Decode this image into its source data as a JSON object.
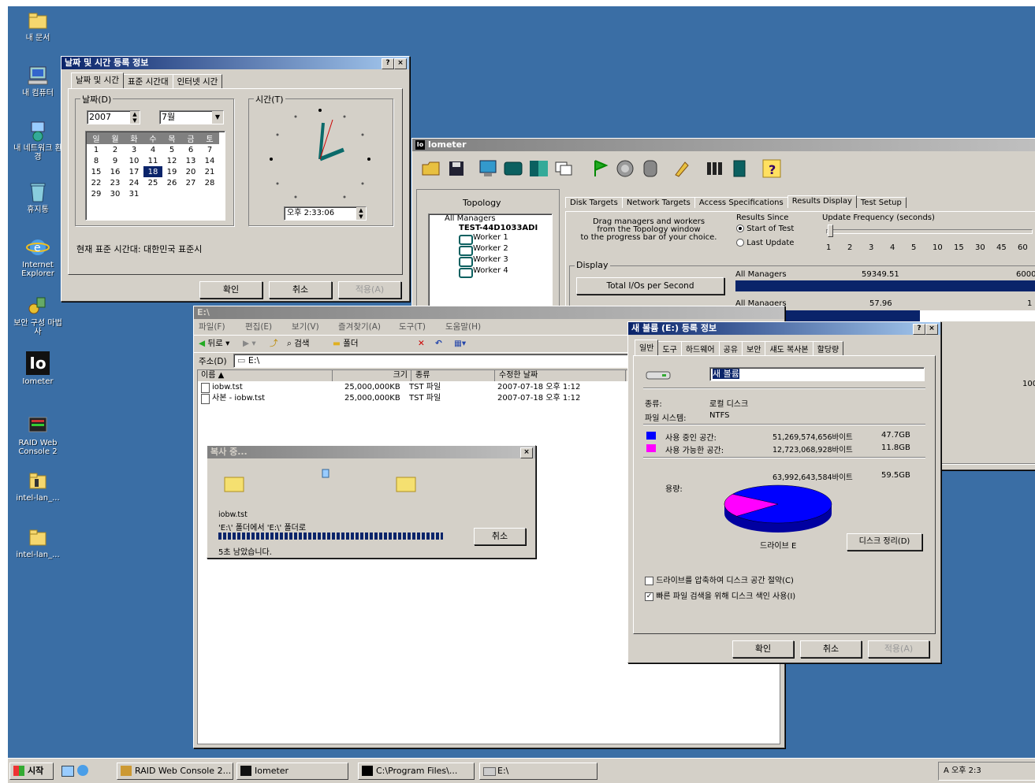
{
  "desktop": {
    "icons": [
      {
        "label": "내 문서"
      },
      {
        "label": "내 컴퓨터"
      },
      {
        "label": "내 네트워크 환경"
      },
      {
        "label": "휴지통"
      },
      {
        "label": "Internet Explorer"
      },
      {
        "label": "보안 구성 마법사"
      },
      {
        "label": "Iometer"
      },
      {
        "label": "RAID Web Console 2"
      },
      {
        "label": "intel-lan_..."
      },
      {
        "label": "intel-lan_..."
      }
    ]
  },
  "datetime": {
    "title": "날짜 및 시간 등록 정보",
    "tabs": [
      "날짜 및 시간",
      "표준 시간대",
      "인터넷 시간"
    ],
    "date_group": "날짜(D)",
    "year": "2007",
    "month": "7월",
    "weekdays": [
      "일",
      "월",
      "화",
      "수",
      "목",
      "금",
      "토"
    ],
    "weeks": [
      [
        "1",
        "2",
        "3",
        "4",
        "5",
        "6",
        "7"
      ],
      [
        "8",
        "9",
        "10",
        "11",
        "12",
        "13",
        "14"
      ],
      [
        "15",
        "16",
        "17",
        "18",
        "19",
        "20",
        "21"
      ],
      [
        "22",
        "23",
        "24",
        "25",
        "26",
        "27",
        "28"
      ],
      [
        "29",
        "30",
        "31",
        "",
        "",
        "",
        ""
      ]
    ],
    "selected_day": "18",
    "time_group": "시간(T)",
    "time_value": "오후 2:33:06",
    "timezone": "현재 표준 시간대: 대한민국 표준시",
    "ok": "확인",
    "cancel": "취소",
    "apply": "적용(A)"
  },
  "iometer": {
    "title": "Iometer",
    "topology_label": "Topology",
    "tree": [
      "All Managers",
      "TEST-44D1033ADI",
      "Worker 1",
      "Worker 2",
      "Worker 3",
      "Worker 4"
    ],
    "tabs": [
      "Disk Targets",
      "Network Targets",
      "Access Specifications",
      "Results Display",
      "Test Setup"
    ],
    "drag_text": [
      "Drag managers and workers",
      "from the Topology window",
      "to the progress bar of your choice."
    ],
    "results_since": "Results Since",
    "start_of_test": "Start of Test",
    "last_update": "Last Update",
    "update_freq": "Update Frequency (seconds)",
    "freq_ticks": [
      "1",
      "2",
      "3",
      "4",
      "5",
      "10",
      "15",
      "30",
      "45",
      "60"
    ],
    "display_label": "Display",
    "metric_button": "Total I/Os per Second",
    "rows": [
      {
        "label": "All Managers",
        "value": "59349.51",
        "max": "6000",
        "fill": 1.0
      },
      {
        "label": "All Managers",
        "value": "57.96",
        "max": "1",
        "fill": 0.6
      }
    ],
    "extra_value": "100"
  },
  "explorer": {
    "title": "E:\\",
    "menu": [
      "파일(F)",
      "편집(E)",
      "보기(V)",
      "즐겨찾기(A)",
      "도구(T)",
      "도움말(H)"
    ],
    "back": "뒤로",
    "search": "검색",
    "folders": "폴더",
    "address_label": "주소(D)",
    "address": "E:\\",
    "columns": [
      "이름",
      "크기",
      "종류",
      "수정한 날짜"
    ],
    "files": [
      {
        "name": "iobw.tst",
        "size": "25,000,000KB",
        "type": "TST 파일",
        "date": "2007-07-18 오후 1:12"
      },
      {
        "name": "사본 - iobw.tst",
        "size": "25,000,000KB",
        "type": "TST 파일",
        "date": "2007-07-18 오후 1:12"
      }
    ]
  },
  "copy": {
    "title": "복사 중...",
    "file": "iobw.tst",
    "from_to": "'E:\\' 폴더에서 'E:\\' 폴더로",
    "remaining": "5초 남았습니다.",
    "cancel": "취소",
    "progress": 0.92
  },
  "props": {
    "title": "새 볼륨 (E:) 등록 정보",
    "tabs": [
      "일반",
      "도구",
      "하드웨어",
      "공유",
      "보안",
      "섀도 복사본",
      "할당량"
    ],
    "volume_name": "새 볼륨",
    "type_label": "종류:",
    "type_value": "로컬 디스크",
    "fs_label": "파일 시스템:",
    "fs_value": "NTFS",
    "used_label": "사용 중인 공간:",
    "used_bytes": "51,269,574,656바이트",
    "used_gb": "47.7GB",
    "free_label": "사용 가능한 공간:",
    "free_bytes": "12,723,068,928바이트",
    "free_gb": "11.8GB",
    "cap_label": "용량:",
    "cap_bytes": "63,992,643,584바이트",
    "cap_gb": "59.5GB",
    "drive_label": "드라이브 E",
    "cleanup": "디스크 정리(D)",
    "compress": "드라이브를 압축하여 디스크 공간 절약(C)",
    "index": "빠른 파일 검색을 위해 디스크 색인 사용(I)",
    "used_fraction": 0.801,
    "used_color": "#0000ff",
    "free_color": "#ff00ff",
    "ok": "확인",
    "cancel": "취소",
    "apply": "적용(A)"
  },
  "taskbar": {
    "start": "시작",
    "tasks": [
      "RAID Web Console 2...",
      "Iometer",
      "C:\\Program Files\\...",
      "E:\\"
    ],
    "tray": "A  오후 2:3"
  }
}
